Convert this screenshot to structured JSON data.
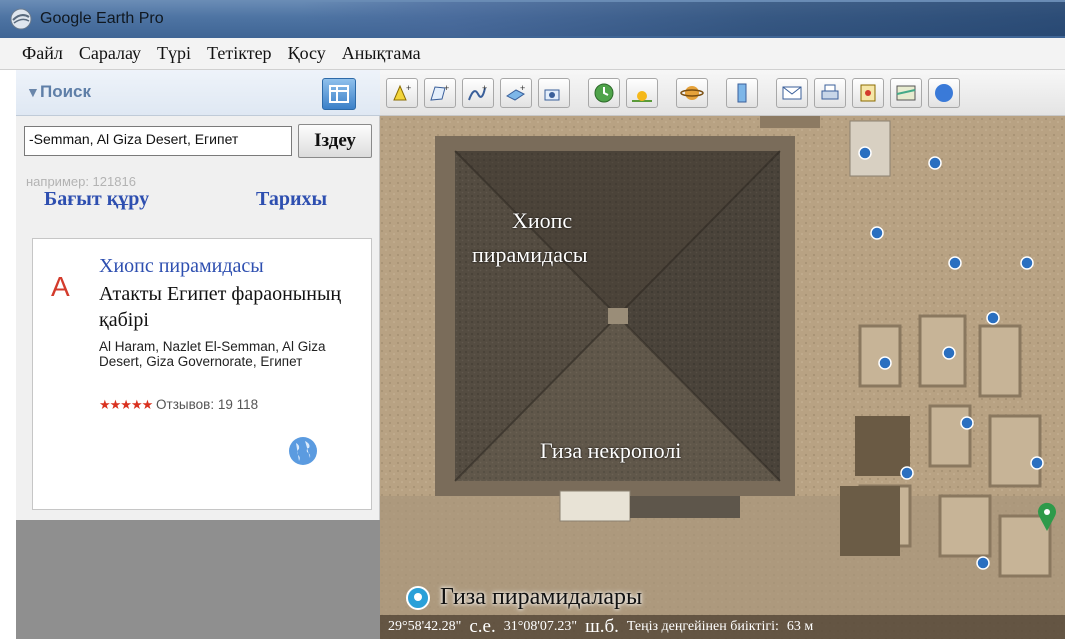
{
  "window": {
    "title": "Google Earth Pro"
  },
  "menu": [
    "Файл",
    "Саралау",
    "Түрі",
    "Тетіктер",
    "Қосу",
    "Анықтама"
  ],
  "search_panel": {
    "header": "Поиск",
    "query": "-Semman, Al Giza Desert, Египет",
    "search_button": "Іздеу",
    "hint": "например: 121816",
    "route_link": "Бағыт құру",
    "history_link": "Тарихы"
  },
  "result": {
    "letter": "A",
    "name": "Хиопс пирамидасы",
    "description": "Атакты Египет фараонының қабірі",
    "address": "Al Haram, Nazlet El-Semman, Al Giza Desert, Giza Governorate, Египет",
    "stars": "★★★★★",
    "reviews": "Отзывов: 19 118"
  },
  "map": {
    "label_pyramid_line1": "Хиопс",
    "label_pyramid_line2": "пирамидасы",
    "label_necropolis": "Гиза некрополі",
    "place_title": "Гиза пирамидалары",
    "status": {
      "lat": "29°58'42.28\"",
      "lat_suffix": "с.е.",
      "lon": "31°08'07.23\"",
      "lon_suffix": "ш.б.",
      "elevation": "Теңіз деңгейінен биіктігі:",
      "elevation_value": "63 м"
    }
  },
  "colors": {
    "accent_blue": "#2e4fb0",
    "marker_red": "#d33b2c"
  }
}
